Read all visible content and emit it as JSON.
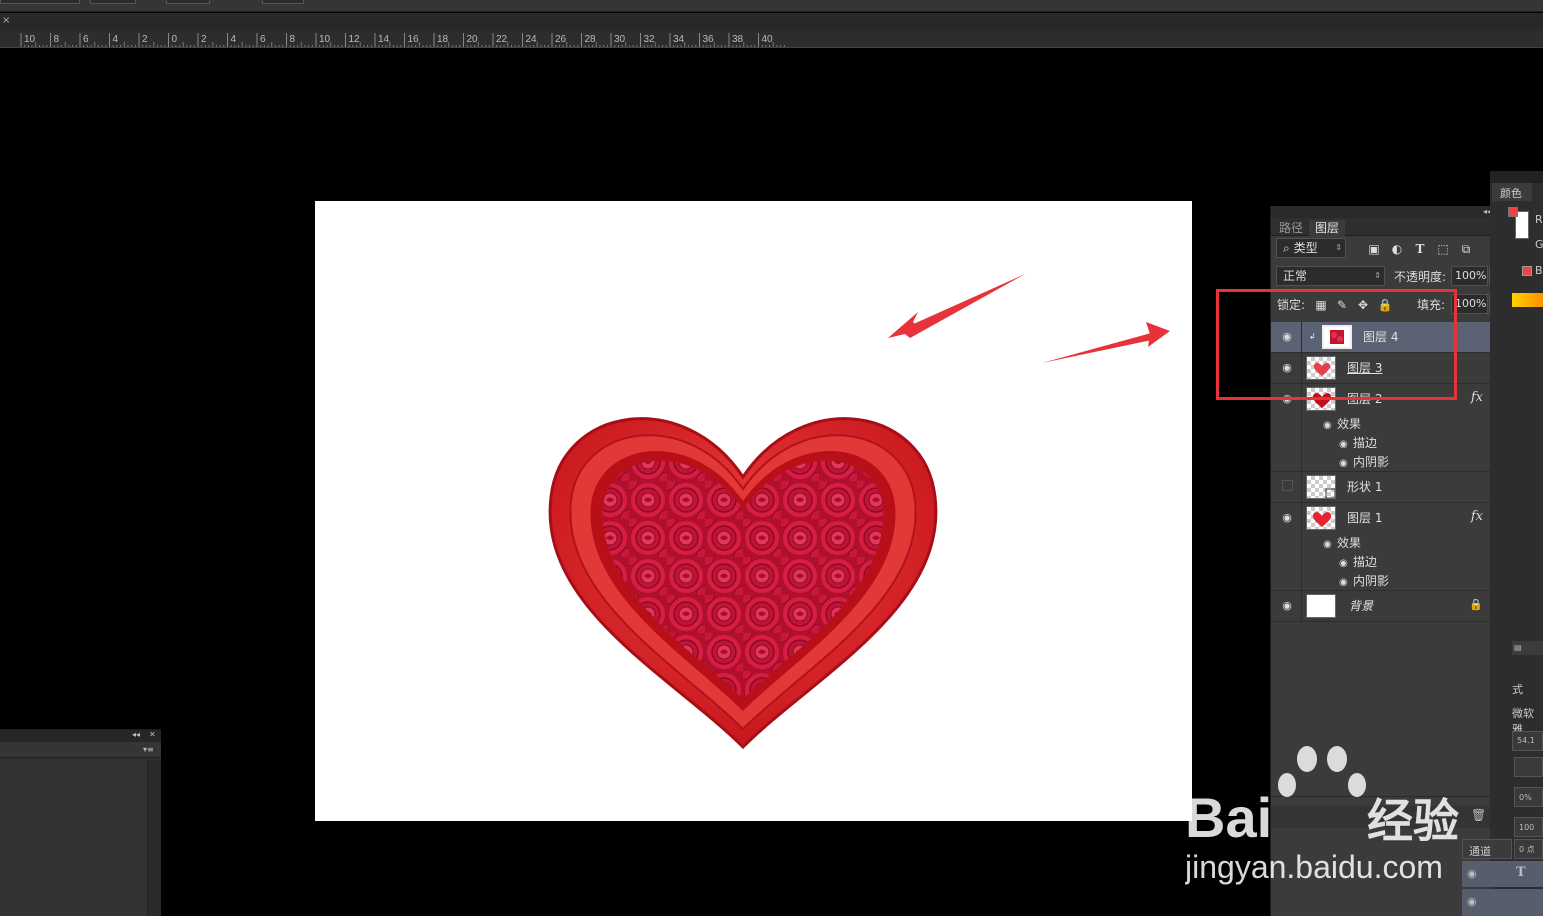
{
  "ruler": {
    "labels": [
      "10",
      "8",
      "6",
      "4",
      "2",
      "0",
      "2",
      "4",
      "6",
      "8",
      "10",
      "12",
      "14",
      "16",
      "18",
      "20",
      "22",
      "24",
      "26",
      "28",
      "30",
      "32",
      "34",
      "36",
      "38",
      "40"
    ]
  },
  "doc_tab": {
    "close_glyph": "×"
  },
  "layers_panel": {
    "tabs": [
      {
        "label": "路径",
        "active": false
      },
      {
        "label": "图层",
        "active": true
      }
    ],
    "filter": {
      "label": "类型"
    },
    "blend_mode": "正常",
    "opacity": {
      "label": "不透明度:",
      "value": "100%"
    },
    "lock": {
      "label": "锁定:"
    },
    "fill": {
      "label": "填充:",
      "value": "100%"
    },
    "layers": [
      {
        "name": "图层 4",
        "visible": true,
        "selected": true,
        "clipped": true,
        "thumb": "roses"
      },
      {
        "name": "图层 3",
        "visible": true,
        "selected": false,
        "thumb": "heart"
      },
      {
        "name": "图层 2",
        "visible": true,
        "selected": false,
        "thumb": "heart-dark",
        "fx": "fx",
        "effects_label": "效果",
        "effects": [
          "描边",
          "内阴影"
        ]
      },
      {
        "name": "形状 1",
        "visible": false,
        "selected": false,
        "thumb": "shape"
      },
      {
        "name": "图层 1",
        "visible": true,
        "selected": false,
        "thumb": "heart",
        "fx": "fx",
        "effects_label": "效果",
        "effects": [
          "描边",
          "内阴影"
        ]
      },
      {
        "name": "背景",
        "visible": true,
        "selected": false,
        "thumb": "white",
        "locked": true
      }
    ]
  },
  "right_panel": {
    "color_tab": "颜色",
    "channels_tab": "通道",
    "font_name": "微软雅",
    "fields": [
      "54.1",
      "0%",
      "100",
      "0 点"
    ],
    "labels": [
      "R",
      "G",
      "B",
      "式"
    ]
  },
  "watermark": {
    "brand_left": "Bai",
    "brand_right": "经验",
    "url": "jingyan.baidu.com"
  },
  "colors": {
    "annotation_red": "#e8323a",
    "heart_red": "#d8141c",
    "selected_layer": "#5a6273"
  }
}
